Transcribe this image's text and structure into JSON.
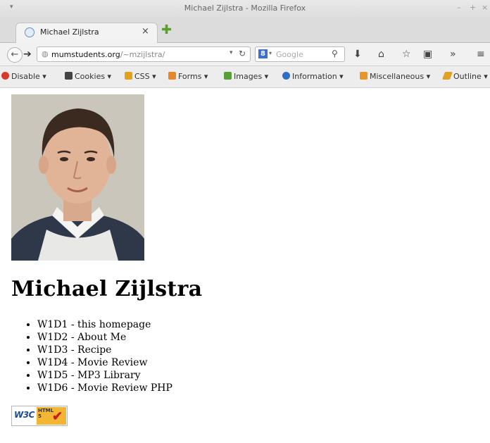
{
  "window": {
    "title": "Michael Zijlstra - Mozilla Firefox"
  },
  "tab": {
    "label": "Michael Zijlstra",
    "close": "×"
  },
  "navbar": {
    "url_domain": "mumstudents.org",
    "url_path": "/~mzijlstra/",
    "search_placeholder": "Google"
  },
  "devbar": {
    "items": [
      {
        "label": "Disable ▾",
        "icon": "disable-icon",
        "color": "#d8392b"
      },
      {
        "label": "Cookies ▾",
        "icon": "cookies-icon",
        "color": "#444444"
      },
      {
        "label": "CSS ▾",
        "icon": "css-icon",
        "color": "#e3a21a"
      },
      {
        "label": "Forms ▾",
        "icon": "forms-icon",
        "color": "#e8862a"
      },
      {
        "label": "Images ▾",
        "icon": "images-icon",
        "color": "#5a9e3a"
      },
      {
        "label": "Information ▾",
        "icon": "information-icon",
        "color": "#2d6fc7"
      },
      {
        "label": "Miscellaneous ▾",
        "icon": "miscellaneous-icon",
        "color": "#e8952a"
      },
      {
        "label": "Outline ▾",
        "icon": "outline-icon",
        "color": "#e0a020"
      }
    ]
  },
  "page": {
    "heading": "Michael Zijlstra",
    "assignments": [
      "W1D1 - this homepage",
      "W1D2 - About Me",
      "W1D3 - Recipe",
      "W1D4 - Movie Review",
      "W1D5 - MP3 Library",
      "W1D6 - Movie Review PHP"
    ],
    "badge": {
      "w3c": "W3C",
      "html": "HTML",
      "five": "5"
    }
  }
}
